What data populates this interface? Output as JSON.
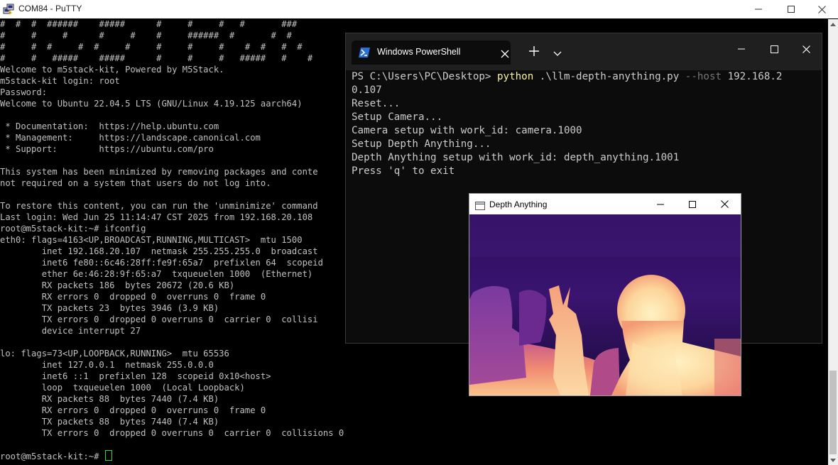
{
  "putty": {
    "title": "COM84 - PuTTY",
    "lines": [
      "#  #  #  ######    #####      #     #     #   #       ###",
      "#     #     #      #     #    #     ######  #       #  #",
      "#     #  #     #  #     #     #     #     #    #  #   #  #",
      "#     #   #####    #####      #     #     #   #####   #    #",
      "Welcome to m5stack-kit, Powered by M5Stack.",
      "m5stack-kit login: root",
      "Password:",
      "Welcome to Ubuntu 22.04.5 LTS (GNU/Linux 4.19.125 aarch64)",
      "",
      " * Documentation:  https://help.ubuntu.com",
      " * Management:     https://landscape.canonical.com",
      " * Support:        https://ubuntu.com/pro",
      "",
      "This system has been minimized by removing packages and conte",
      "not required on a system that users do not log into.",
      "",
      "To restore this content, you can run the 'unminimize' command",
      "Last login: Wed Jun 25 11:14:47 CST 2025 from 192.168.20.108",
      "root@m5stack-kit:~# ifconfig",
      "eth0: flags=4163<UP,BROADCAST,RUNNING,MULTICAST>  mtu 1500",
      "        inet 192.168.20.107  netmask 255.255.255.0  broadcast",
      "        inet6 fe80::6c46:28ff:fe9f:65a7  prefixlen 64  scopeid",
      "        ether 6e:46:28:9f:65:a7  txqueuelen 1000  (Ethernet)",
      "        RX packets 186  bytes 20672 (20.6 KB)",
      "        RX errors 0  dropped 0  overruns 0  frame 0",
      "        TX packets 23  bytes 3946 (3.9 KB)",
      "        TX errors 0  dropped 0 overruns 0  carrier 0  collisi",
      "        device interrupt 27",
      "",
      "lo: flags=73<UP,LOOPBACK,RUNNING>  mtu 65536",
      "        inet 127.0.0.1  netmask 255.0.0.0",
      "        inet6 ::1  prefixlen 128  scopeid 0x10<host>",
      "        loop  txqueuelen 1000  (Local Loopback)",
      "        RX packets 88  bytes 7440 (7.4 KB)",
      "        RX errors 0  dropped 0  overruns 0  frame 0",
      "        TX packets 88  bytes 7440 (7.4 KB)",
      "        TX errors 0  dropped 0 overruns 0  carrier 0  collisions 0",
      "",
      "root@m5stack-kit:~# "
    ],
    "scroll_thumb_color": "#c1c1c1"
  },
  "powershell": {
    "tab_title": "Windows PowerShell",
    "prompt": "PS C:\\Users\\PC\\Desktop> ",
    "command": "python",
    "args": " .\\llm-depth-anything.py ",
    "param": "--host",
    "value": " 192.168.2",
    "wrapped": "0.107",
    "output": [
      "Reset...",
      "Setup Camera...",
      "Camera setup with work_id: camera.1000",
      "Setup Depth Anything...",
      "Depth Anything setup with work_id: depth_anything.1001",
      "Press 'q' to exit"
    ],
    "accent": "#f9f1a5"
  },
  "depth_window": {
    "title": "Depth Anything",
    "colormap": [
      "#1a0a3a",
      "#4a1a78",
      "#8b3aa0",
      "#d8607a",
      "#f7b07a",
      "#fde4b0"
    ]
  },
  "icons": {
    "putty": "putty-icon",
    "powershell": "powershell-icon",
    "depth": "app-window-icon"
  }
}
